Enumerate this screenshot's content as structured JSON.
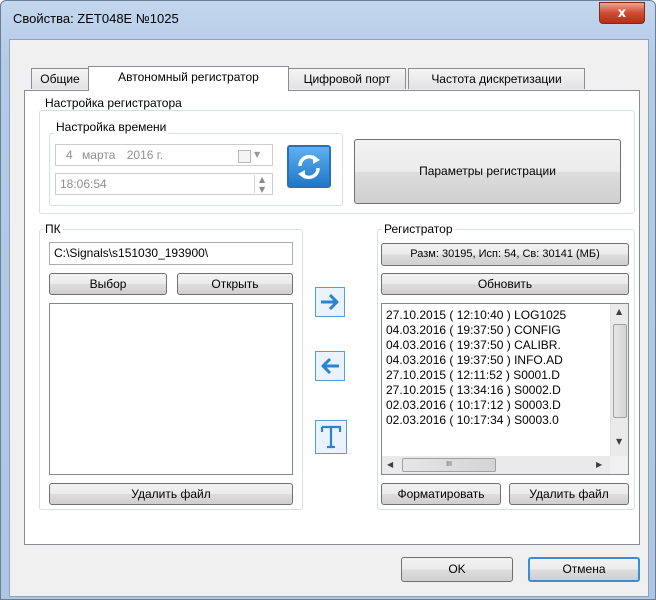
{
  "window": {
    "title": "Свойства: ZET048E №1025",
    "close_glyph": "x"
  },
  "tabs": [
    {
      "label": "Общие"
    },
    {
      "label": "Автономный регистратор"
    },
    {
      "label": "Цифровой порт"
    },
    {
      "label": "Частота дискретизации"
    }
  ],
  "recorder_settings": {
    "group_label": "Настройка регистратора",
    "time_group_label": "Настройка времени",
    "date_day": "4",
    "date_month": "марта",
    "date_year": "2016 г.",
    "time_value": "18:06:54",
    "params_button": "Параметры регистрации"
  },
  "pc": {
    "group_label": "ПК",
    "path": "C:\\Signals\\s151030_193900\\",
    "choose_button": "Выбор",
    "open_button": "Открыть",
    "delete_button": "Удалить файл"
  },
  "transfer": {
    "to_recorder_icon": "arrow-right-icon",
    "to_pc_icon": "arrow-left-icon",
    "text_icon": "text-t-icon"
  },
  "recorder": {
    "group_label": "Регистратор",
    "size_info": "Разм: 30195, Исп: 54, Св: 30141 (МБ)",
    "refresh_button": "Обновить",
    "files": [
      "27.10.2015 ( 12:10:40 ) LOG1025",
      "04.03.2016 ( 19:37:50 ) CONFIG",
      "04.03.2016 ( 19:37:50 ) CALIBR.",
      "04.03.2016 ( 19:37:50 ) INFO.AD",
      "27.10.2015 ( 12:11:52 ) S0001.D",
      "27.10.2015 ( 13:34:16 ) S0002.D",
      "02.03.2016 ( 10:17:12 ) S0003.D",
      "02.03.2016 ( 10:17:34 ) S0003.0"
    ],
    "format_button": "Форматировать",
    "delete_button": "Удалить файл",
    "hscroll_grip": "III"
  },
  "dialog": {
    "ok_button": "OK",
    "cancel_button": "Отмена"
  },
  "colors": {
    "accent_blue": "#3c8bd8",
    "icon_blue": "#2a84d2"
  }
}
